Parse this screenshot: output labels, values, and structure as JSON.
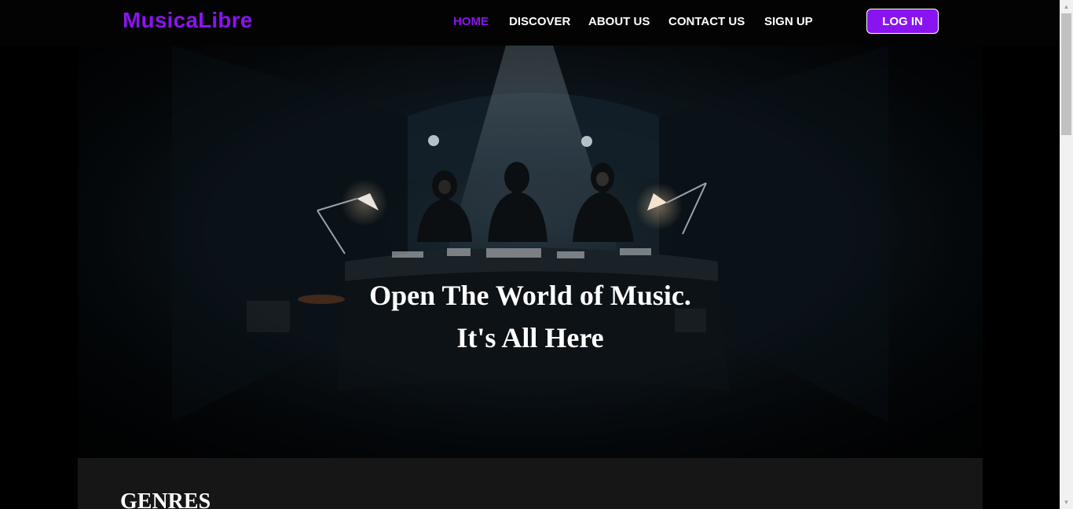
{
  "nav": {
    "brand": "MusicaLibre",
    "links": [
      {
        "label": "HOME",
        "active": true
      },
      {
        "label": "DISCOVER",
        "active": false
      },
      {
        "label": "ABOUT US",
        "active": false
      },
      {
        "label": "CONTACT US",
        "active": false
      },
      {
        "label": "SIGN UP",
        "active": false
      }
    ],
    "login_label": "LOG IN"
  },
  "hero": {
    "line1": "Open The World of Music.",
    "line2": "It's All Here"
  },
  "genres": {
    "heading": "GENRES"
  },
  "colors": {
    "accent": "#8a14f0",
    "nav_bg": "#030303",
    "section_bg": "#161616"
  }
}
